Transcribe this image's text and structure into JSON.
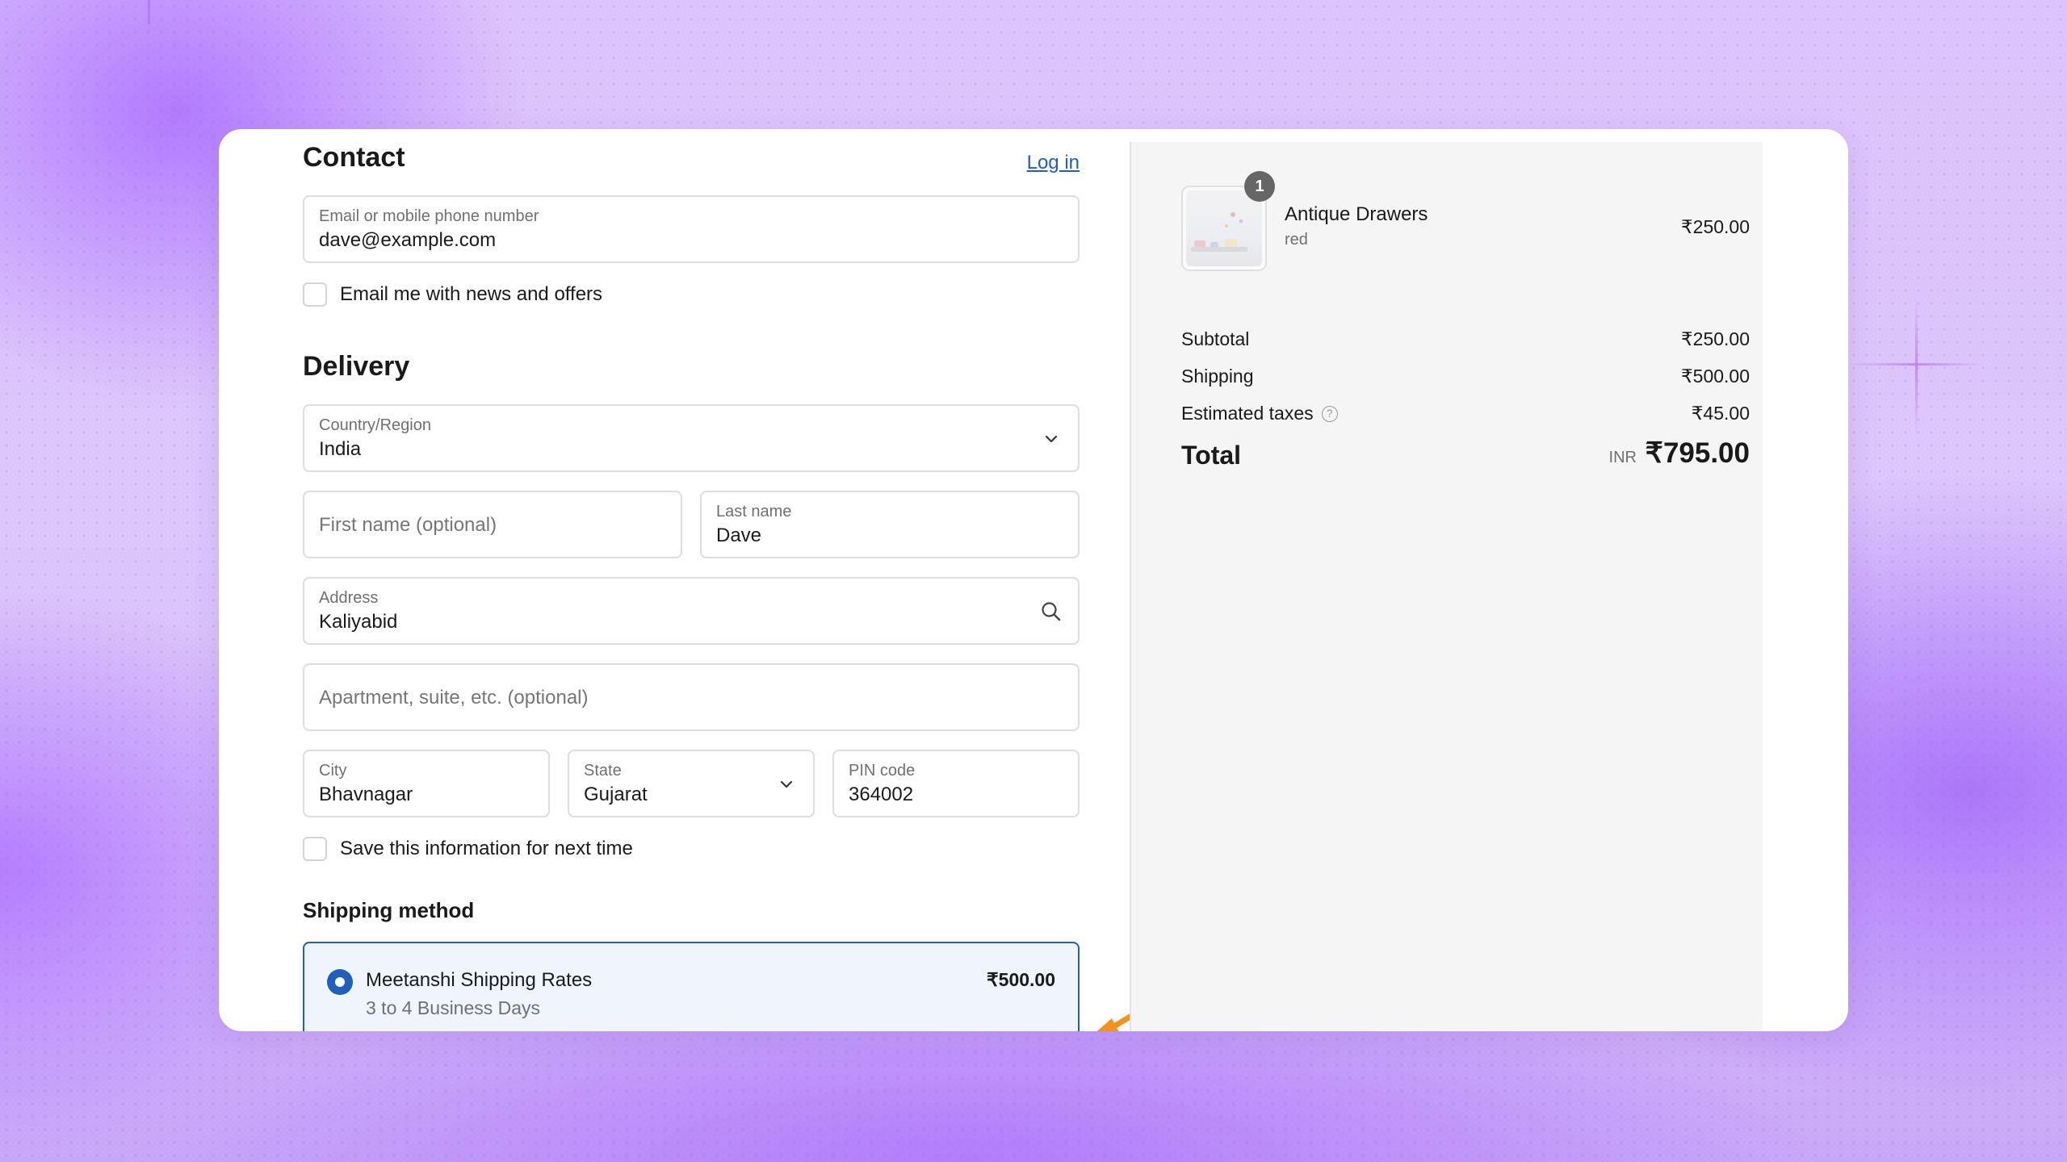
{
  "contact": {
    "title": "Contact",
    "login_link": "Log in",
    "email_label": "Email or mobile phone number",
    "email_value": "dave@example.com",
    "news_checkbox_label": "Email me with news and offers"
  },
  "delivery": {
    "title": "Delivery",
    "country_label": "Country/Region",
    "country_value": "India",
    "first_name_placeholder": "First name (optional)",
    "last_name_label": "Last name",
    "last_name_value": "Dave",
    "address_label": "Address",
    "address_value": "Kaliyabid",
    "apartment_placeholder": "Apartment, suite, etc. (optional)",
    "city_label": "City",
    "city_value": "Bhavnagar",
    "state_label": "State",
    "state_value": "Gujarat",
    "pin_label": "PIN code",
    "pin_value": "364002",
    "save_info_label": "Save this information for next time"
  },
  "shipping_method": {
    "title": "Shipping method",
    "option_name": "Meetanshi Shipping Rates",
    "option_days": "3 to 4 Business Days",
    "option_price": "₹500.00"
  },
  "summary": {
    "product": {
      "quantity": "1",
      "name": "Antique Drawers",
      "variant": "red",
      "price": "₹250.00"
    },
    "subtotal_label": "Subtotal",
    "subtotal_value": "₹250.00",
    "shipping_label": "Shipping",
    "shipping_value": "₹500.00",
    "taxes_label": "Estimated taxes",
    "taxes_help_icon": "?",
    "taxes_value": "₹45.00",
    "total_label": "Total",
    "total_currency": "INR",
    "total_value": "₹795.00"
  },
  "colors": {
    "accent": "#1f5fbf",
    "arrow": "#f5921e"
  }
}
